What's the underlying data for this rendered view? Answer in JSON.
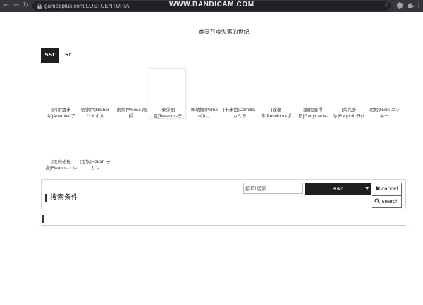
{
  "browser": {
    "url": "game6plus.com/LOSTCENTURIA",
    "watermark": "WWW.BANDICAM.COM"
  },
  "page": {
    "title": "魔灵召唤失落的世纪"
  },
  "tabs": [
    {
      "label": "ssr",
      "active": true
    },
    {
      "label": "sr",
      "active": false
    }
  ],
  "characters": [
    {
      "line1": "[阿尔缇米",
      "line2": "尔]Artamiel-ア"
    },
    {
      "line1": "[哈索尔]Hathor-",
      "line2": "ハトホル"
    },
    {
      "line1": "[雨师]Woosa-雨",
      "line2": "師"
    },
    {
      "line1": "[泰莎丽",
      "line2": "恩]Tesarion-テ"
    },
    {
      "line1": "[佩勒娜]Perna-",
      "line2": "ペルナ"
    },
    {
      "line1": "[卡米拉]Camilla-",
      "line2": "カミラ"
    },
    {
      "line1": "[波塞",
      "line2": "冬]Poseidon-ポ"
    },
    {
      "line1": "[伽倪墨得",
      "line2": "斯]Ganymede-"
    },
    {
      "line1": "[莱克多",
      "line2": "尔]Raqdoll-ラグ"
    },
    {
      "line1": "[尼姬]Nicki-ニッ",
      "line2": "キー"
    },
    {
      "line1": "[埃莉诺化",
      "line2": "身]Eleanor-エレ"
    },
    {
      "line1": "[拉坎]Rakan-ラ",
      "line2": "カン"
    }
  ],
  "search": {
    "title": "搜索条件",
    "id_placeholder": "按ID搜索",
    "select_value": "ssr",
    "cancel_label": "cancel",
    "search_label": "search"
  },
  "icons": {
    "back": "arrow-left-icon",
    "forward": "arrow-right-icon",
    "reload": "reload-icon",
    "lock": "lock-icon",
    "star": "star-icon",
    "cancel": "close-icon",
    "search": "search-icon"
  }
}
